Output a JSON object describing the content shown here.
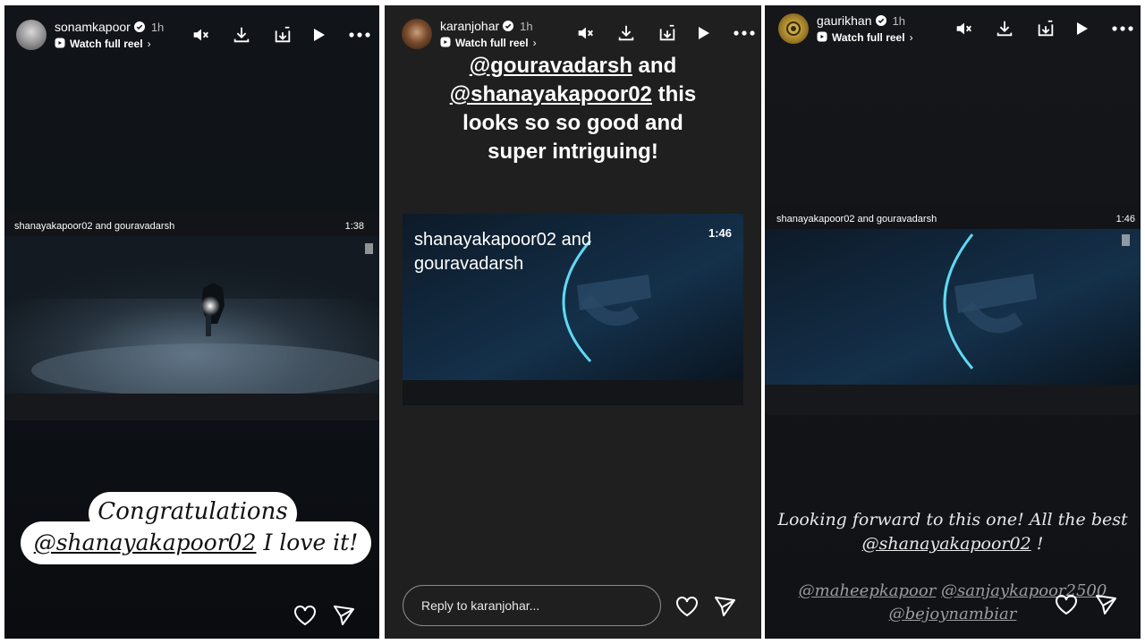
{
  "stories": [
    {
      "username": "sonamkapoor",
      "time": "1h",
      "watch_label": "Watch full reel",
      "reel_title": "shanayakapoor02 and gouravadarsh",
      "reel_duration": "1:38",
      "caption_line1": "Congratulations",
      "caption_mention": "@shanayakapoor02",
      "caption_tail": " I love it!"
    },
    {
      "username": "karanjohar",
      "time": "1h",
      "watch_label": "Watch full reel",
      "text_mention1": "@gouravadarsh",
      "text_and": " and",
      "text_mention2": "@shanayakapoor02",
      "text_rest1": " this",
      "text_line3": "looks so so good and",
      "text_line4": "super intriguing!",
      "reel_title_line1": "shanayakapoor02 and",
      "reel_title_line2": "gouravadarsh",
      "reel_duration": "1:46",
      "reply_placeholder": "Reply to karanjohar..."
    },
    {
      "username": "gaurikhan",
      "time": "1h",
      "watch_label": "Watch full reel",
      "reel_title": "shanayakapoor02 and gouravadarsh",
      "reel_duration": "1:46",
      "caption_line1": "Looking forward to this one! All the best",
      "caption_mention": "@shanayakapoor02",
      "caption_bang": " !",
      "tag1": "@maheepkapoor",
      "tag2": "@sanjaykapoor2500",
      "tag3": "@bejoynambiar"
    }
  ],
  "icons": [
    "mute-icon",
    "download-icon",
    "save-icon",
    "play-icon",
    "more-icon",
    "heart-icon",
    "send-icon",
    "verified-icon"
  ],
  "colors": {
    "accent_ring": "#5fd8f2",
    "text": "#ffffff"
  }
}
